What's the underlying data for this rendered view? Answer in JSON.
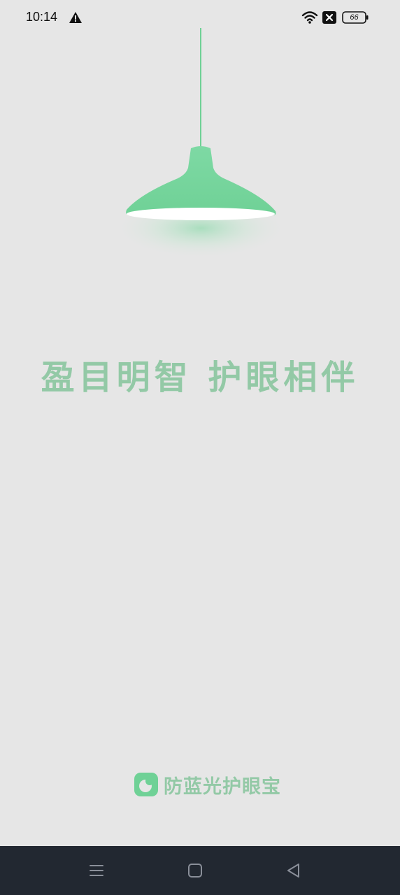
{
  "status_bar": {
    "time": "10:14",
    "battery": "66",
    "icons": [
      "warning-icon",
      "wifi-icon",
      "notification-x-icon",
      "battery-icon"
    ]
  },
  "splash": {
    "slogan": "盈目明智  护眼相伴",
    "brand_name": "防蓝光护眼宝",
    "accent_color": "#6fd196",
    "text_color": "#93c9a6"
  },
  "nav_bar": {
    "icons": [
      "menu-icon",
      "home-icon",
      "back-icon"
    ]
  }
}
